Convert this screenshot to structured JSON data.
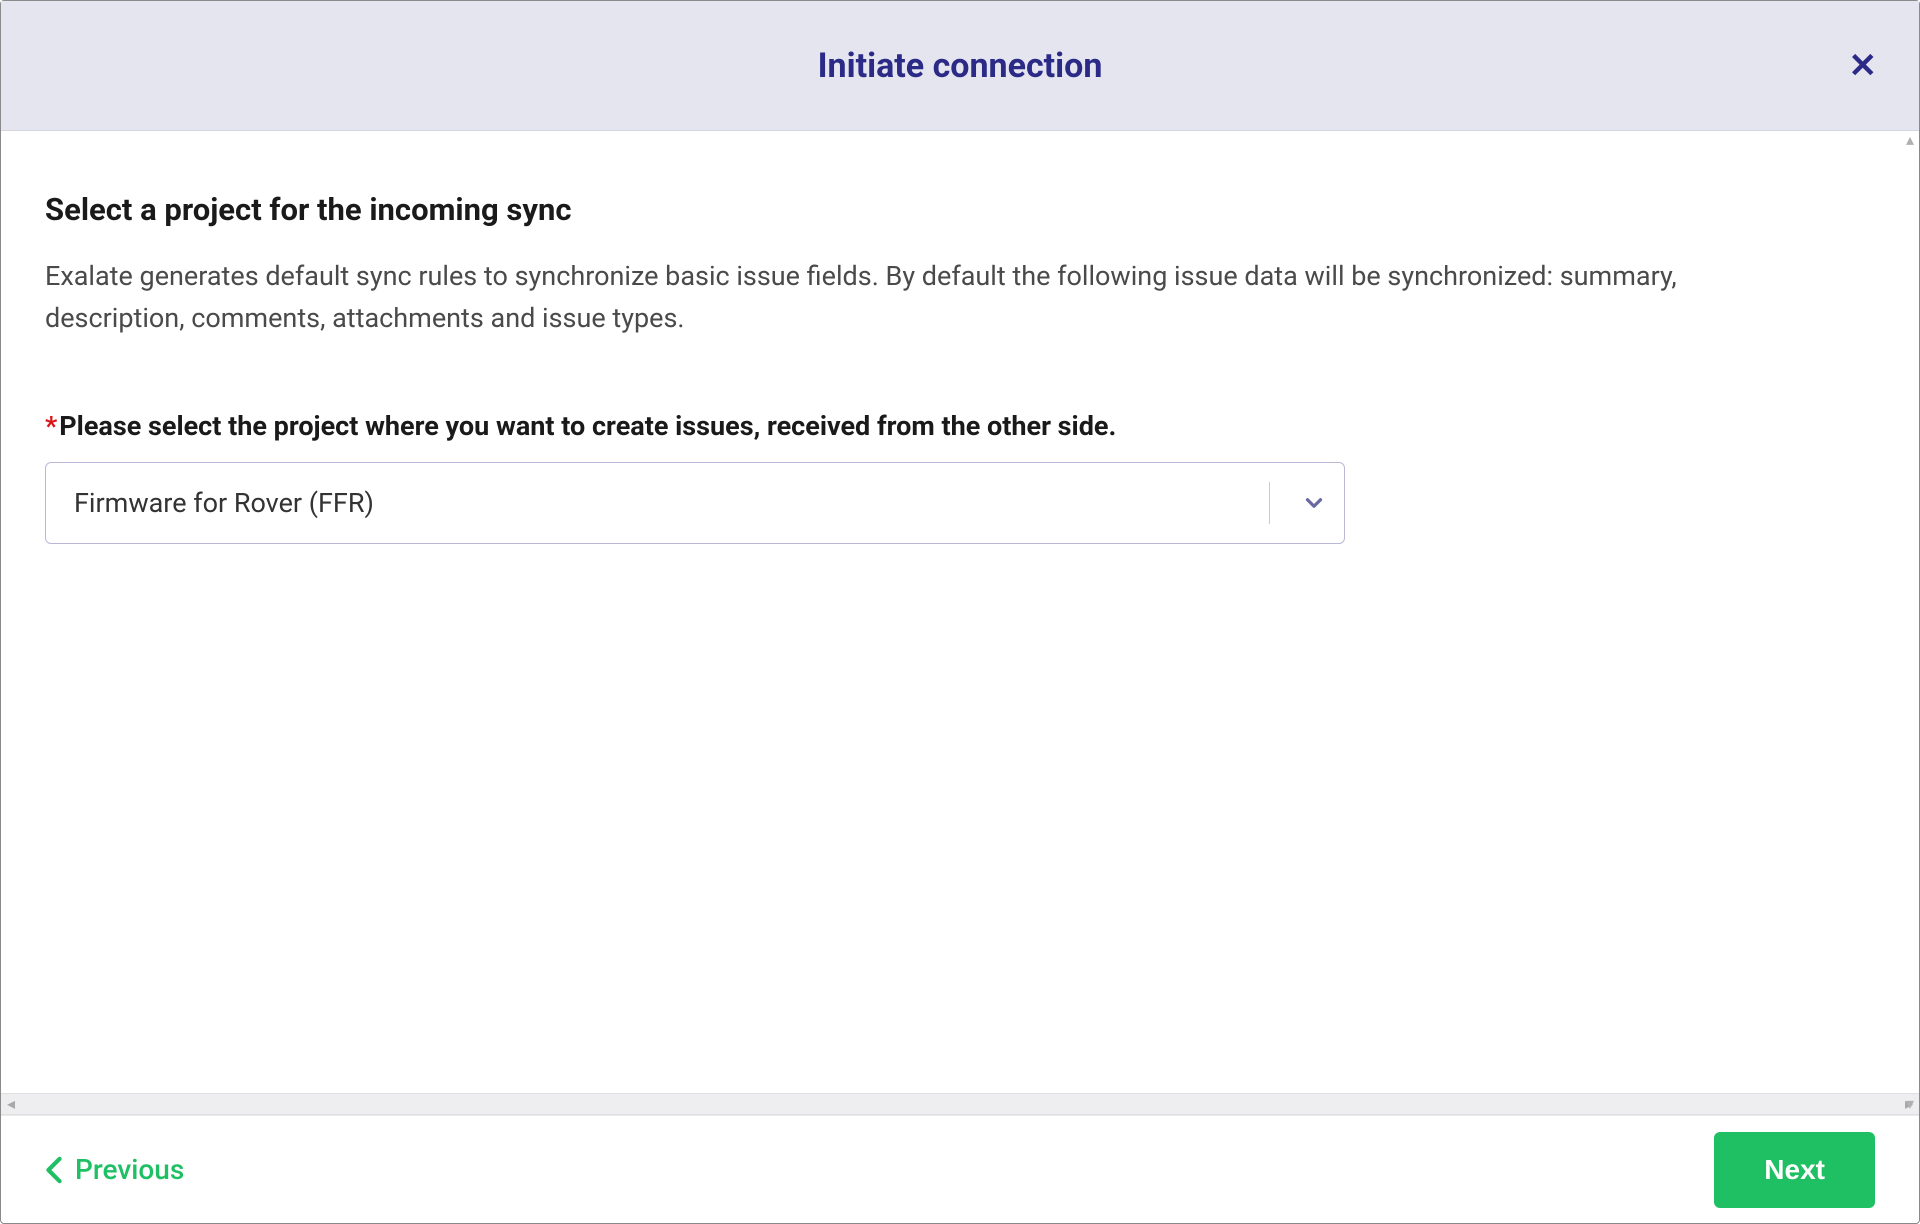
{
  "header": {
    "title": "Initiate connection"
  },
  "body": {
    "heading": "Select a project for the incoming sync",
    "description": "Exalate generates default sync rules to synchronize basic issue fields. By default the following issue data will be synchronized: summary, description, comments, attachments and issue types.",
    "field": {
      "required_mark": "*",
      "label": "Please select the project where you want to create issues, received from the other side.",
      "selected": "Firmware for Rover (FFR)"
    }
  },
  "footer": {
    "previous": "Previous",
    "next": "Next"
  }
}
